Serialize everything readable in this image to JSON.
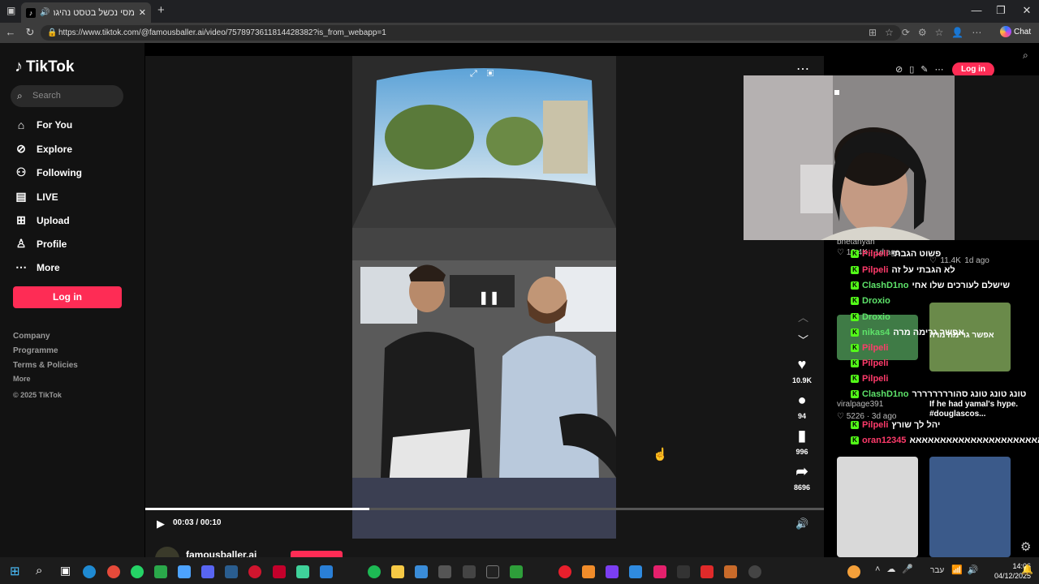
{
  "browser": {
    "tab_title": "מסי נכשל בטסט נהיגה מול רו",
    "url": "https://www.tiktok.com/@famousballer.ai/video/7578973611814428382?is_from_webapp=1",
    "chat_label": "Chat"
  },
  "sidebar": {
    "brand": "TikTok",
    "search_placeholder": "Search",
    "nav": [
      {
        "label": "For You",
        "icon": "home-icon"
      },
      {
        "label": "Explore",
        "icon": "compass-icon"
      },
      {
        "label": "Following",
        "icon": "following-icon"
      },
      {
        "label": "LIVE",
        "icon": "live-icon"
      },
      {
        "label": "Upload",
        "icon": "upload-icon"
      },
      {
        "label": "Profile",
        "icon": "profile-icon"
      },
      {
        "label": "More",
        "icon": "more-icon"
      }
    ],
    "login_label": "Log in",
    "footer": [
      "Company",
      "Programme",
      "Terms & Policies",
      "More",
      "© 2025 TikTok"
    ]
  },
  "video": {
    "likes": "10.9K",
    "comments": "94",
    "saves": "996",
    "shares": "8696",
    "time": "00:03 / 00:10",
    "progress": 0.33,
    "author": "famousballer.ai"
  },
  "top_right": {
    "login_label": "Log in"
  },
  "chat": [
    {
      "user": "Pilpeli",
      "color": "#ff3b6b",
      "msg": "פשוט הגבתי"
    },
    {
      "user": "Pilpeli",
      "color": "#ff3b6b",
      "msg": "לא הגבתי על זה"
    },
    {
      "user": "ClashD1no",
      "color": "#5ee36a",
      "msg": "שישלם לעורכים שלו אחי"
    },
    {
      "user": "Droxio",
      "color": "#5ee36a",
      "msg": ""
    },
    {
      "user": "Droxio",
      "color": "#5ee36a",
      "msg": ""
    },
    {
      "user": "nikas4",
      "color": "#5ee36a",
      "msg": "אפשר גרימה מרה"
    },
    {
      "user": "Pilpeli",
      "color": "#ff3b6b",
      "msg": ""
    },
    {
      "user": "Pilpeli",
      "color": "#ff3b6b",
      "msg": ""
    },
    {
      "user": "Pilpeli",
      "color": "#ff3b6b",
      "msg": ""
    },
    {
      "user": "ClashD1no",
      "color": "#5ee36a",
      "msg": "טונג טונג טונג סהורררררררר"
    },
    {
      "user": "Pilpeli",
      "color": "#ff3b6b",
      "msg": "יהל לך שורץ"
    },
    {
      "user": "oran12345",
      "color": "#ff3b6b",
      "msg": "אאאאאאאאאאאאאאאאאאאאאא"
    }
  ],
  "related": {
    "u1": "bnetanyah",
    "v1": "12.4K",
    "d1": "1d ago",
    "v2": "11.4K",
    "d2": "1d ago",
    "u3": "viralpage391",
    "v3": "5226",
    "d3": "3d ago",
    "cap": "If he had yamal's hype. #douglascos...",
    "tag": "אפשר גרימה מרה"
  },
  "taskbar": {
    "time": "14:06",
    "date": "04/12/2025",
    "lang": "עבר"
  }
}
